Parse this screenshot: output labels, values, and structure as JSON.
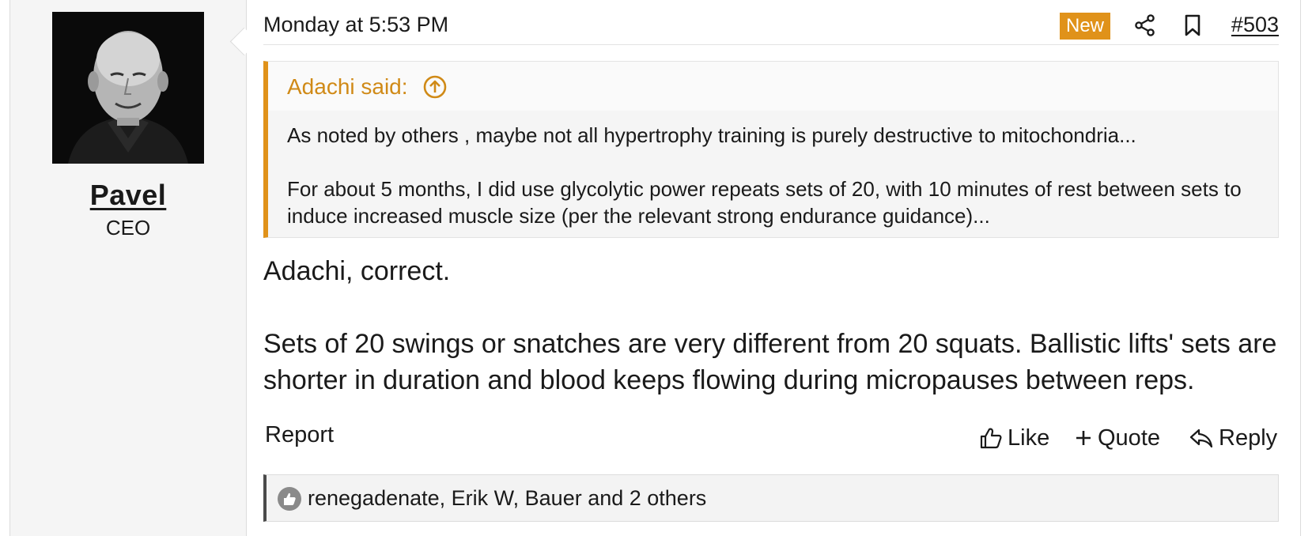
{
  "user": {
    "name": "Pavel",
    "title": "CEO",
    "avatar_label": "user-avatar"
  },
  "post": {
    "date": "Monday at 5:53 PM",
    "new_badge": "New",
    "number": "#503",
    "quote": {
      "author_label": "Adachi said:",
      "paragraphs": [
        "As noted by others , maybe not all hypertrophy training is purely destructive to mitochondria...",
        "For about 5 months, I did use glycolytic power repeats sets of 20, with 10 minutes of rest between sets to induce increased muscle size (per the relevant strong endurance guidance)..."
      ]
    },
    "body": [
      "Adachi, correct.",
      "Sets of 20 swings or snatches are very different from 20 squats. Ballistic lifts' sets are shorter in duration and blood keeps flowing during micropauses between reps."
    ]
  },
  "actions": {
    "report": "Report",
    "like": "Like",
    "quote": "Quote",
    "reply": "Reply"
  },
  "reactions": {
    "text": "renegadenate, Erik W, Bauer and 2 others"
  },
  "colors": {
    "accent": "#e0921a",
    "quote_author": "#d08a17",
    "text": "#1a1a1a",
    "user_panel_bg": "#f5f5f5"
  },
  "icons": [
    "share-icon",
    "bookmark-icon",
    "quote-jump-icon",
    "like-icon",
    "plus-icon",
    "reply-icon",
    "reaction-like-icon"
  ]
}
